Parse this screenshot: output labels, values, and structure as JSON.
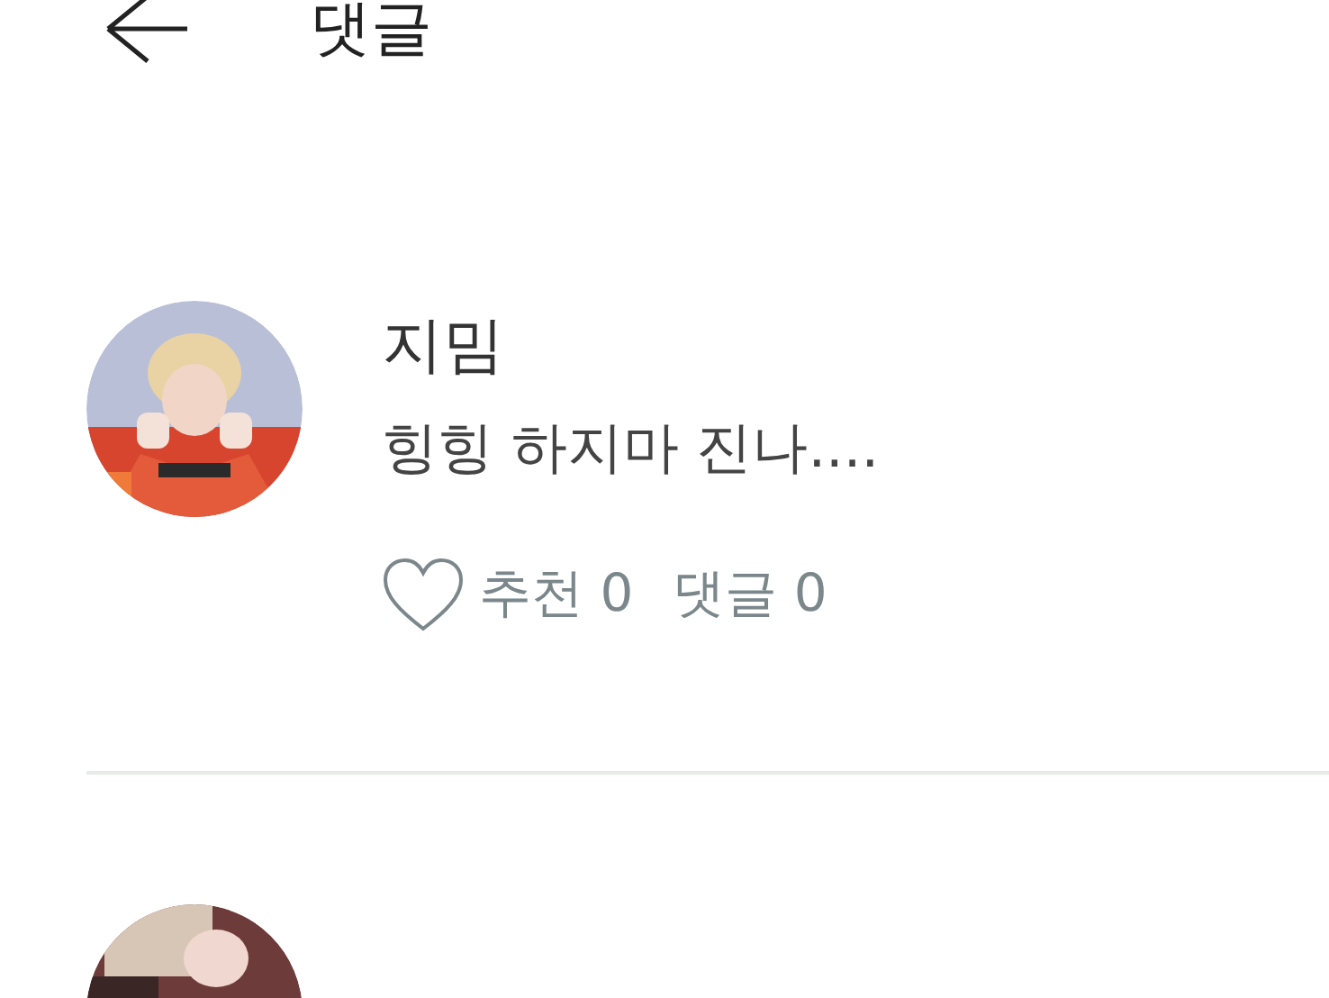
{
  "header": {
    "title": "댓글"
  },
  "comments": [
    {
      "kind": "full",
      "author": "지밈",
      "text": "힝힝 하지마 진나....",
      "liked": false,
      "likes_label": "추천 0",
      "replies_label": "댓글 0"
    },
    {
      "kind": "cut"
    }
  ]
}
